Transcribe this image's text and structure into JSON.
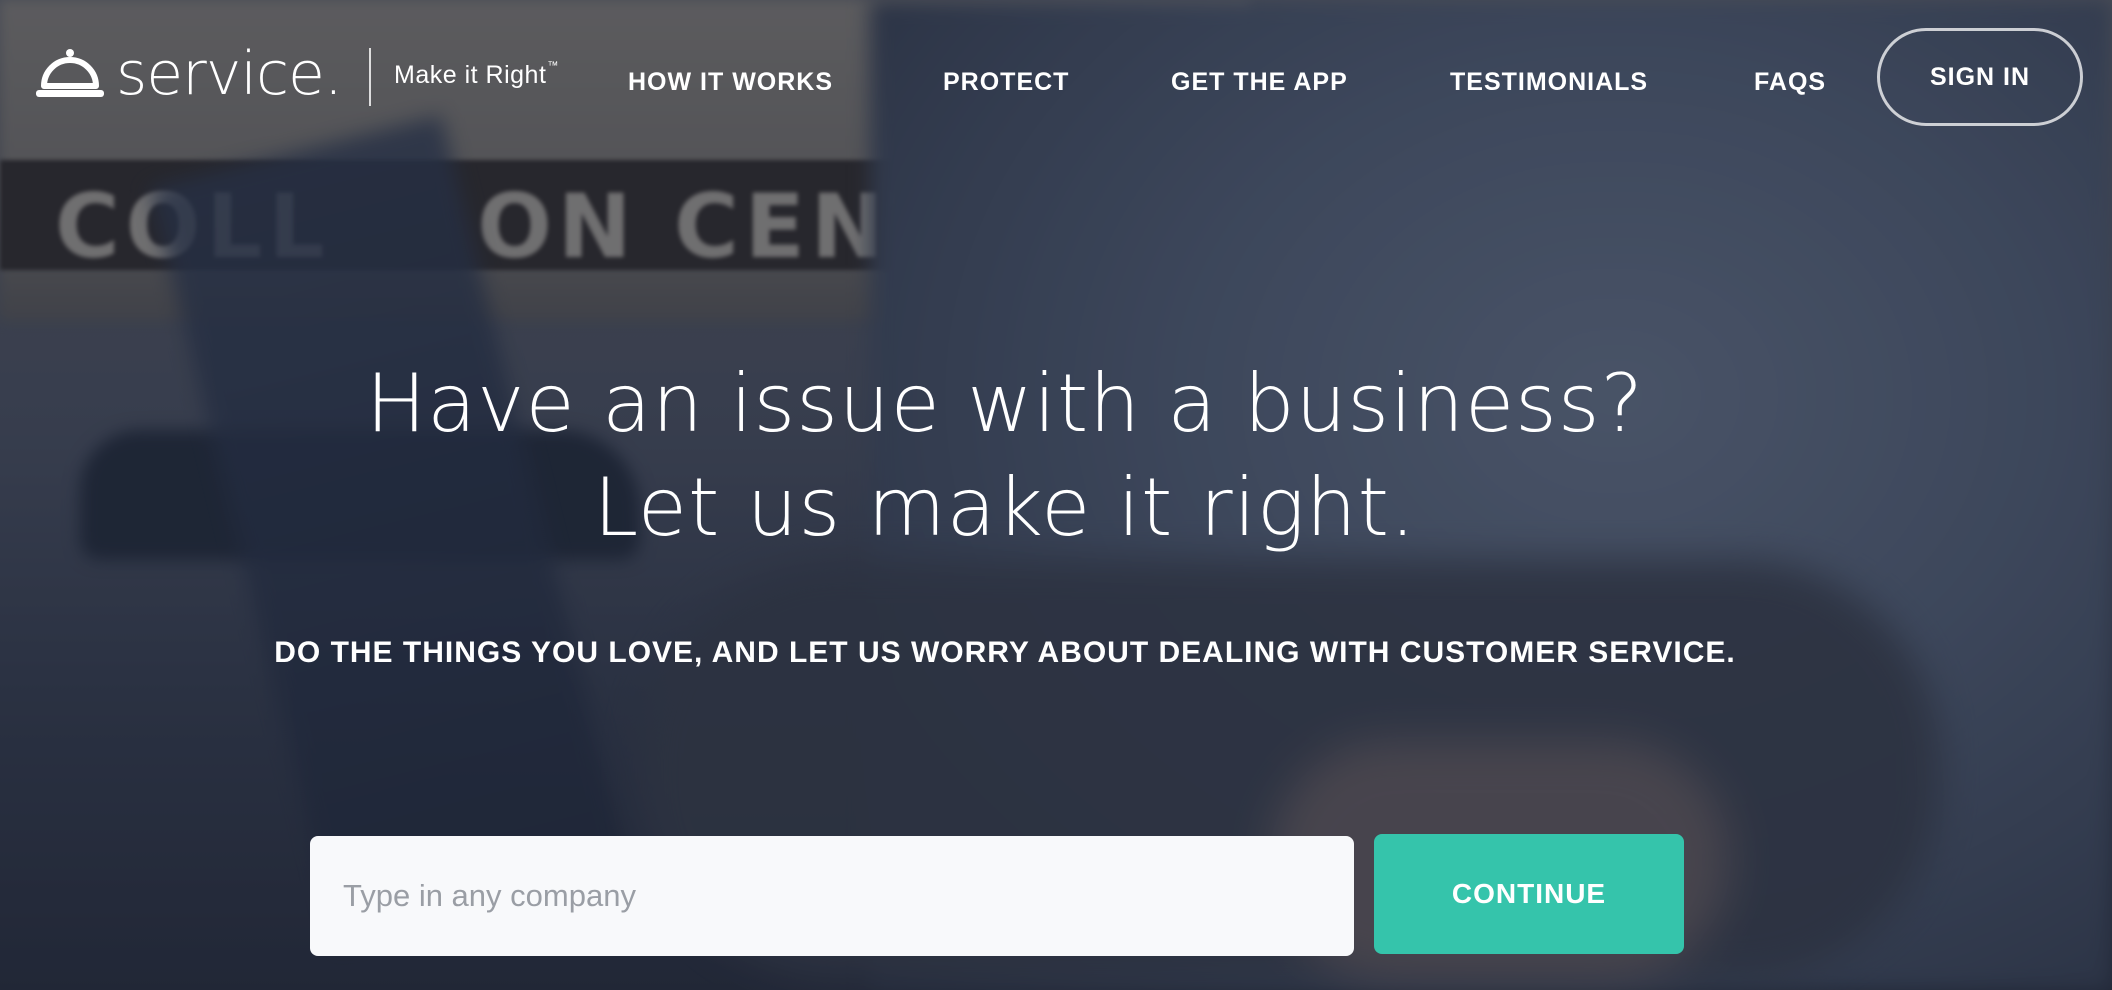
{
  "brand": {
    "name": "service.",
    "tagline": "Make it Right",
    "tagline_mark": "™",
    "logo_icon": "service-bell-icon"
  },
  "nav": {
    "items": [
      {
        "label": "HOW IT WORKS"
      },
      {
        "label": "PROTECT"
      },
      {
        "label": "GET THE APP"
      },
      {
        "label": "TESTIMONIALS"
      },
      {
        "label": "FAQS"
      }
    ],
    "sign_in": "SIGN IN"
  },
  "hero": {
    "headline_line1": "Have an issue with a business?",
    "headline_line2": "Let us make it right.",
    "subhead": "DO THE THINGS YOU LOVE, AND LET US WORRY ABOUT DEALING WITH CUSTOMER SERVICE."
  },
  "search": {
    "placeholder": "Type in any company",
    "value": "",
    "button_label": "CONTINUE"
  },
  "colors": {
    "accent": "#35c4ab",
    "text": "#ffffff",
    "input_bg": "#f8f9fb",
    "overlay": "#1e2434"
  }
}
